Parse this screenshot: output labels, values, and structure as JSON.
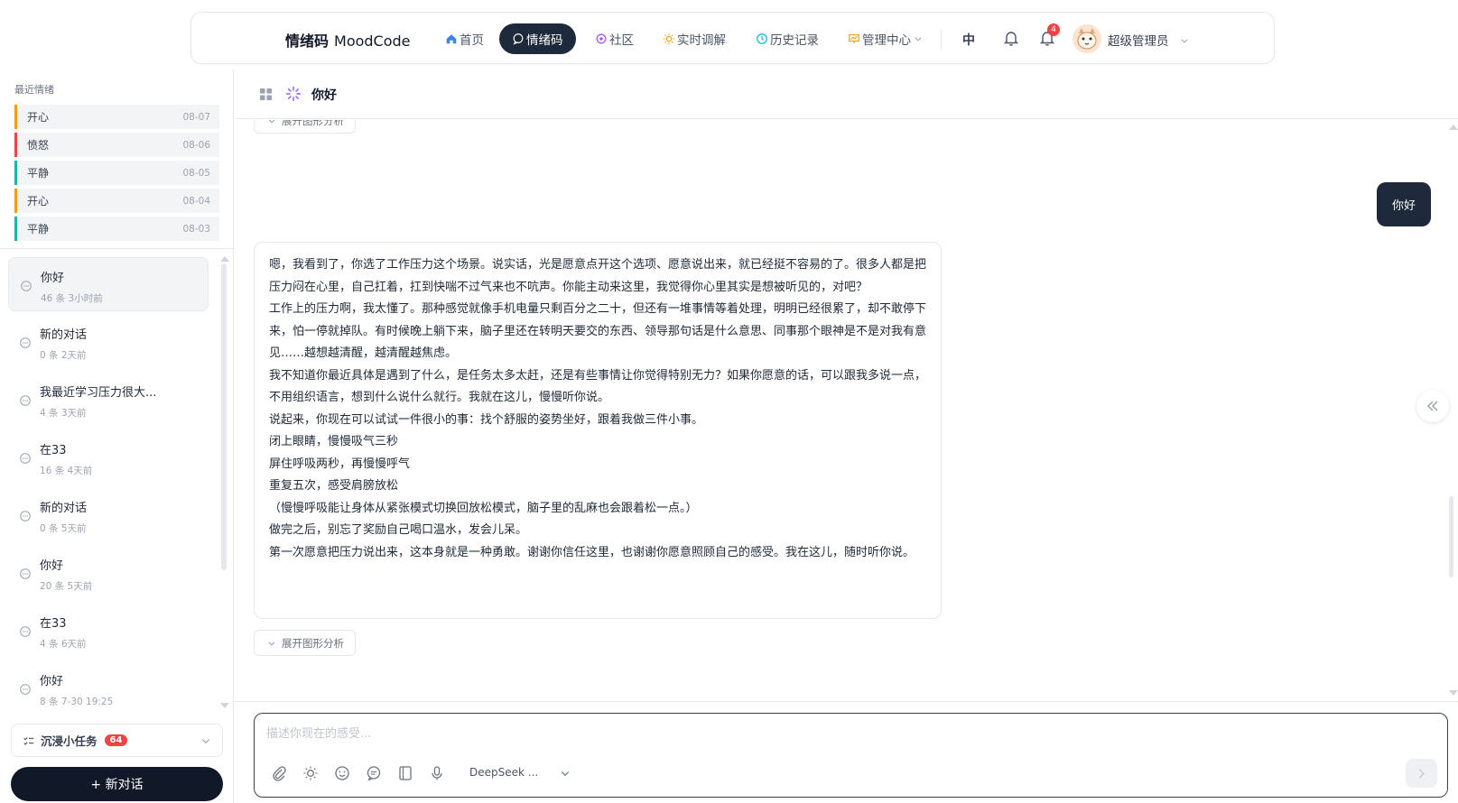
{
  "nav": {
    "brand_cn": "情绪码",
    "brand_en": "MoodCode",
    "items": [
      {
        "label": "首页",
        "icon": "home-icon"
      },
      {
        "label": "情绪码",
        "icon": "chat-bubble-icon",
        "active": true
      },
      {
        "label": "社区",
        "icon": "community-icon"
      },
      {
        "label": "实时调解",
        "icon": "sun-icon"
      },
      {
        "label": "历史记录",
        "icon": "clock-icon"
      },
      {
        "label": "管理中心",
        "icon": "dashboard-icon",
        "dropdown": true
      }
    ],
    "lang": "中",
    "notification_count": "4",
    "username": "超级管理员",
    "accent": "#1e293b"
  },
  "sidebar": {
    "recent_title": "最近情绪",
    "moods": [
      {
        "label": "开心",
        "date": "08-07",
        "color": "#f59e0b"
      },
      {
        "label": "愤怒",
        "date": "08-06",
        "color": "#ef4444"
      },
      {
        "label": "平静",
        "date": "08-05",
        "color": "#14b8a6"
      },
      {
        "label": "开心",
        "date": "08-04",
        "color": "#f59e0b"
      },
      {
        "label": "平静",
        "date": "08-03",
        "color": "#14b8a6"
      }
    ],
    "conversations": [
      {
        "title": "你好",
        "meta": "46 条 3小时前",
        "active": true
      },
      {
        "title": "新的对话",
        "meta": "0 条 2天前"
      },
      {
        "title": "我最近学习压力很大...",
        "meta": "4 条 3天前"
      },
      {
        "title": "在33",
        "meta": "16 条 4天前"
      },
      {
        "title": "新的对话",
        "meta": "0 条 5天前"
      },
      {
        "title": "你好",
        "meta": "20 条 5天前"
      },
      {
        "title": "在33",
        "meta": "4 条 6天前"
      },
      {
        "title": "你好",
        "meta": "8 条 7-30 19:25"
      }
    ],
    "tasks_label": "沉浸小任务",
    "tasks_count": "64",
    "new_chat_label": "+ 新对话"
  },
  "chat": {
    "title": "你好",
    "expand_label": "展开图形分析",
    "user_message": "你好",
    "ai_paragraphs": [
      "嗯，我看到了，你选了工作压力这个场景。说实话，光是愿意点开这个选项、愿意说出来，就已经挺不容易的了。很多人都是把压力闷在心里，自己扛着，扛到快喘不过气来也不吭声。你能主动来这里，我觉得你心里其实是想被听见的，对吧？",
      "工作上的压力啊，我太懂了。那种感觉就像手机电量只剩百分之二十，但还有一堆事情等着处理，明明已经很累了，却不敢停下来，怕一停就掉队。有时候晚上躺下来，脑子里还在转明天要交的东西、领导那句话是什么意思、同事那个眼神是不是对我有意见……越想越清醒，越清醒越焦虑。",
      "我不知道你最近具体是遇到了什么，是任务太多太赶，还是有些事情让你觉得特别无力？如果你愿意的话，可以跟我多说一点，不用组织语言，想到什么说什么就行。我就在这儿，慢慢听你说。",
      "说起来，你现在可以试试一件很小的事：找个舒服的姿势坐好，跟着我做三件小事。",
      "闭上眼睛，慢慢吸气三秒",
      "屏住呼吸两秒，再慢慢呼气",
      "重复五次，感受肩膀放松",
      "（慢慢呼吸能让身体从紧张模式切换回放松模式，脑子里的乱麻也会跟着松一点。）",
      "做完之后，别忘了奖励自己喝口温水，发会儿呆。",
      "第一次愿意把压力说出来，这本身就是一种勇敢。谢谢你信任这里，也谢谢你愿意照顾自己的感受。我在这儿，随时听你说。"
    ]
  },
  "composer": {
    "placeholder": "描述你现在的感受...",
    "model": "DeepSeek ..."
  }
}
